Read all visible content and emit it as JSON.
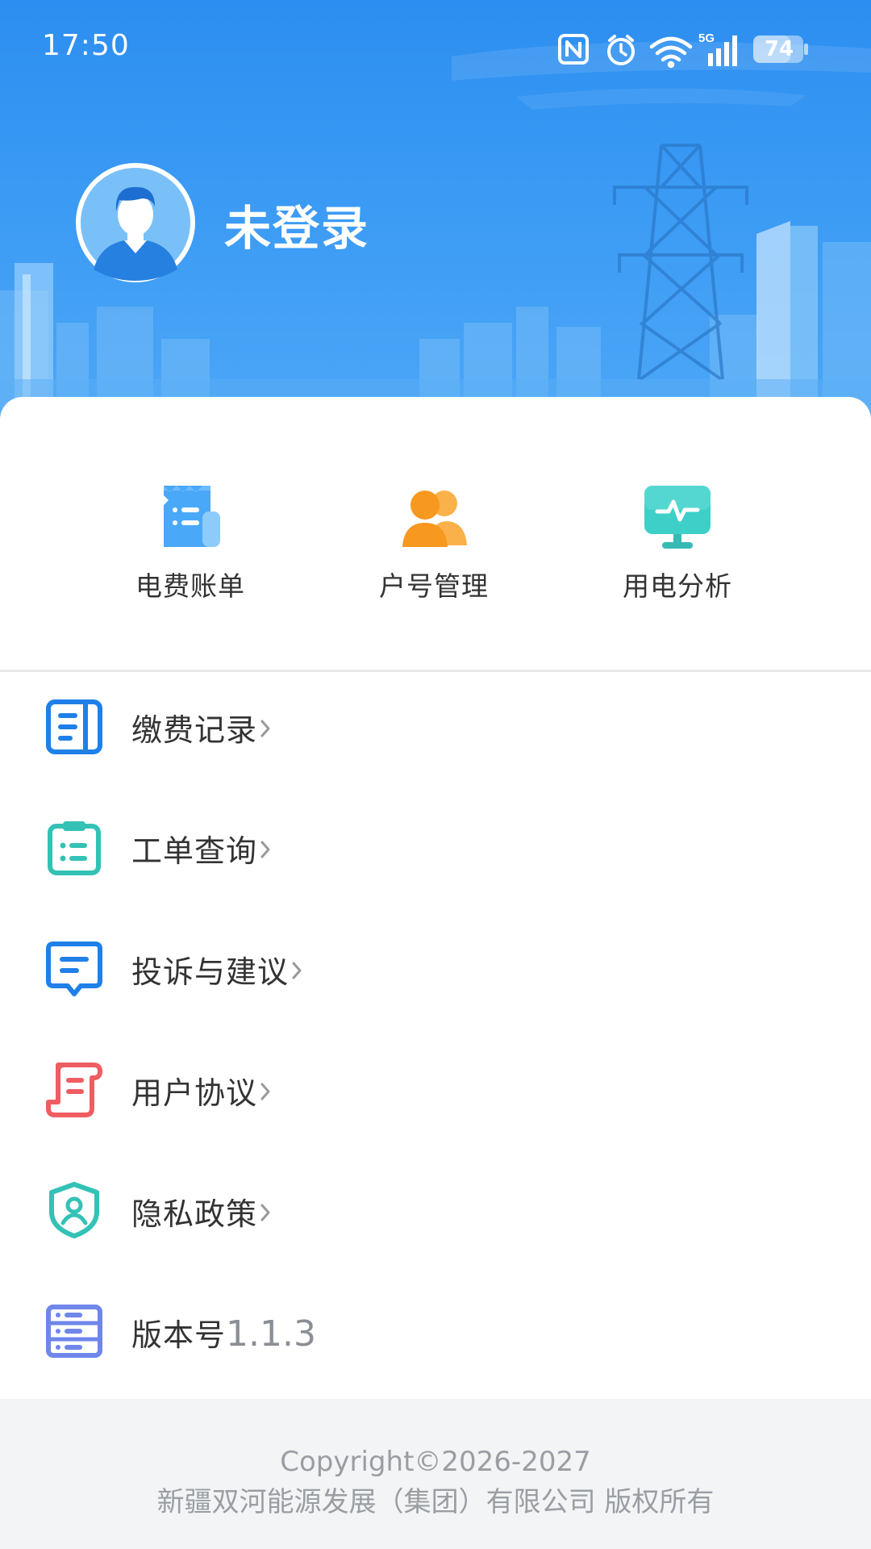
{
  "status_bar": {
    "time": "17:50",
    "network": "5G",
    "battery": "74",
    "icons": [
      "nfc-icon",
      "alarm-icon",
      "wifi-icon",
      "cellular-signal-icon",
      "battery-icon"
    ]
  },
  "profile": {
    "name": "未登录",
    "avatar_icon": "user-avatar-icon"
  },
  "quick_actions": [
    {
      "label": "电费账单",
      "icon": "receipt-icon",
      "color": "#4aa8f8"
    },
    {
      "label": "户号管理",
      "icon": "users-icon",
      "color": "#f7981f"
    },
    {
      "label": "用电分析",
      "icon": "monitor-pulse-icon",
      "color": "#3fcfc9"
    }
  ],
  "menu": [
    {
      "label": "缴费记录",
      "icon": "document-list-icon",
      "color": "#1e80e8",
      "has_arrow": true
    },
    {
      "label": "工单查询",
      "icon": "clipboard-icon",
      "color": "#33c2b5",
      "has_arrow": true
    },
    {
      "label": "投诉与建议",
      "icon": "message-icon",
      "color": "#1e80e8",
      "has_arrow": true
    },
    {
      "label": "用户协议",
      "icon": "scroll-icon",
      "color": "#ee5d62",
      "has_arrow": true
    },
    {
      "label": "隐私政策",
      "icon": "shield-user-icon",
      "color": "#33c2b5",
      "has_arrow": true
    },
    {
      "label": "版本号",
      "value": "1.1.3",
      "icon": "server-icon",
      "color": "#6f86ea",
      "has_arrow": false
    }
  ],
  "footer": {
    "copyright": "Copyright©2026-2027",
    "company": "新疆双河能源发展（集团）有限公司 版权所有"
  },
  "colors": {
    "header_top": "#2c8ef0",
    "header_bottom": "#4ba6f6",
    "text_primary": "#333333",
    "text_muted": "#9a9ea3"
  }
}
